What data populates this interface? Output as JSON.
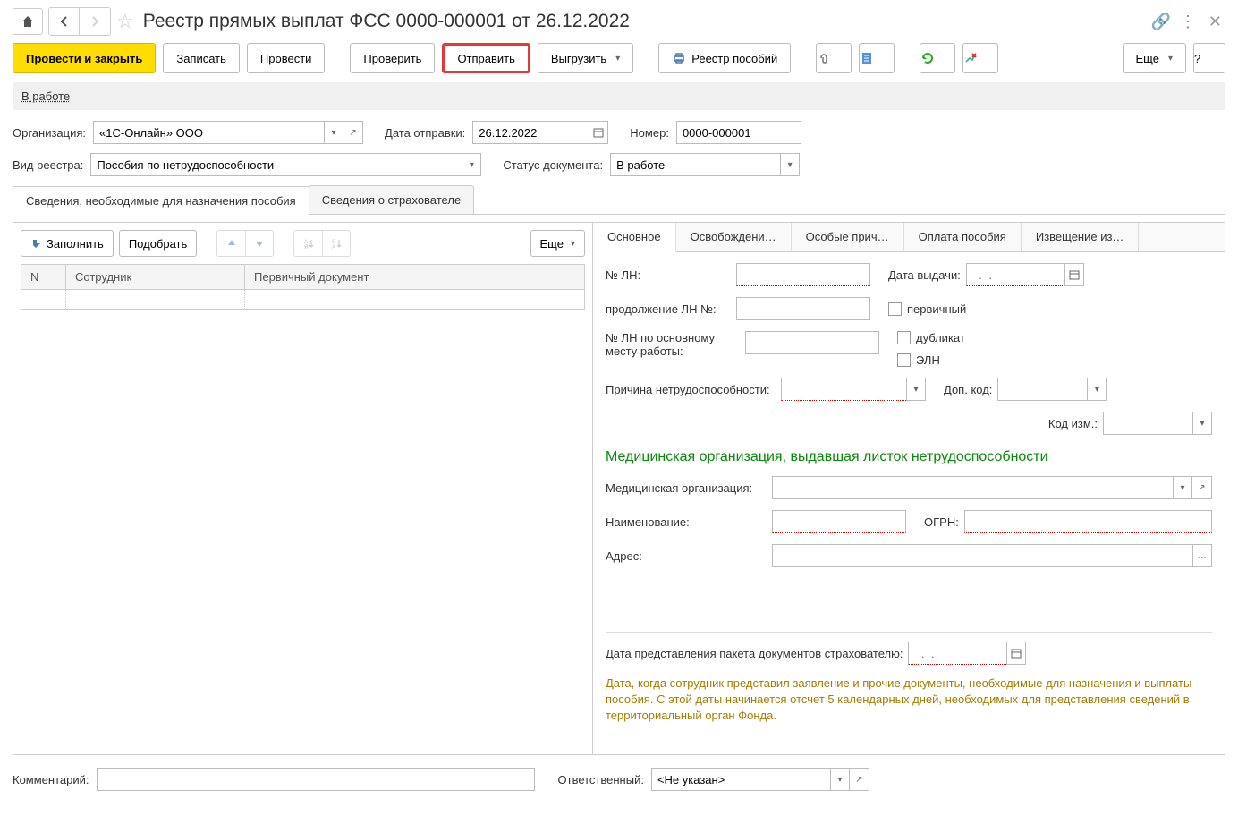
{
  "header": {
    "title": "Реестр прямых выплат ФСС 0000-000001 от 26.12.2022"
  },
  "toolbar": {
    "post_and_close": "Провести и закрыть",
    "save": "Записать",
    "post": "Провести",
    "check": "Проверить",
    "send": "Отправить",
    "export": "Выгрузить",
    "registry": "Реестр пособий",
    "more": "Еще",
    "help": "?"
  },
  "status": {
    "text": "В работе"
  },
  "form": {
    "org_label": "Организация:",
    "org_value": "«1С-Онлайн» ООО",
    "send_date_label": "Дата отправки:",
    "send_date_value": "26.12.2022",
    "number_label": "Номер:",
    "number_value": "0000-000001",
    "reg_type_label": "Вид реестра:",
    "reg_type_value": "Пособия по нетрудоспособности",
    "doc_status_label": "Статус документа:",
    "doc_status_value": "В работе"
  },
  "main_tabs": {
    "tab1": "Сведения, необходимые для назначения пособия",
    "tab2": "Сведения о страхователе"
  },
  "left_toolbar": {
    "fill": "Заполнить",
    "pick": "Подобрать",
    "more": "Еще"
  },
  "table": {
    "col_n": "N",
    "col_emp": "Сотрудник",
    "col_doc": "Первичный документ"
  },
  "inner_tabs": {
    "t1": "Основное",
    "t2": "Освобождени…",
    "t3": "Особые прич…",
    "t4": "Оплата пособия",
    "t5": "Извещение из…"
  },
  "details": {
    "ln_no_label": "№ ЛН:",
    "issue_date_label": "Дата выдачи:",
    "issue_date_placeholder": "  .  .",
    "cont_ln_label": "продолжение ЛН №:",
    "primary_label": "первичный",
    "main_ln_label": "№ ЛН по основному месту работы:",
    "duplicate_label": "дубликат",
    "eln_label": "ЭЛН",
    "reason_label": "Причина нетрудоспособности:",
    "add_code_label": "Доп. код:",
    "change_code_label": "Код изм.:",
    "med_heading": "Медицинская организация, выдавшая листок нетрудоспособности",
    "med_org_label": "Медицинская организация:",
    "name_label": "Наименование:",
    "ogrn_label": "ОГРН:",
    "address_label": "Адрес:",
    "submit_date_label": "Дата представления пакета документов страхователю:",
    "submit_date_placeholder": "  .  .",
    "hint": "Дата, когда сотрудник представил заявление и прочие документы, необходимые для назначения и выплаты пособия. С этой даты начинается отсчет 5 календарных дней, необходимых для представления сведений в территориальный орган Фонда."
  },
  "footer": {
    "comment_label": "Комментарий:",
    "responsible_label": "Ответственный:",
    "responsible_value": "<Не указан>"
  }
}
